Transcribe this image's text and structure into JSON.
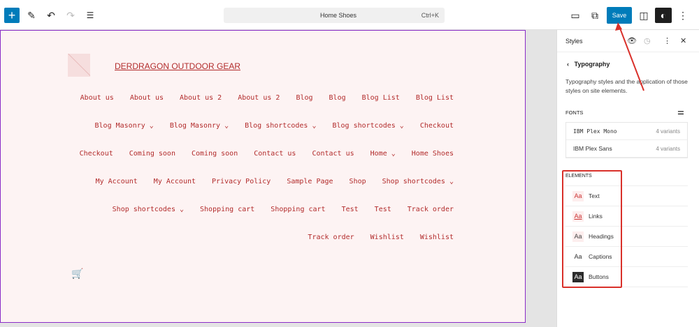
{
  "toolbar": {
    "add": "+",
    "pen": "✎",
    "undo": "↶",
    "redo": "↷",
    "list": "☰",
    "doc_title": "Home Shoes",
    "shortcut": "Ctrl+K",
    "view": "▭",
    "external": "⧉",
    "save": "Save",
    "panel": "◫",
    "styles": "◐",
    "more": "⋮"
  },
  "site": {
    "title": "DERDRAGON OUTDOOR GEAR",
    "nav": [
      "About us",
      "About us",
      "About us 2",
      "About us 2",
      "Blog",
      "Blog",
      "Blog List",
      "Blog List",
      "Blog Masonry ⌄",
      "Blog Masonry ⌄",
      "Blog shortcodes ⌄",
      "Blog shortcodes ⌄",
      "Checkout",
      "Checkout",
      "Coming soon",
      "Coming soon",
      "Contact us",
      "Contact us",
      "Home ⌄",
      "Home Shoes",
      "My Account",
      "My Account",
      "Privacy Policy",
      "Sample Page",
      "Shop",
      "Shop shortcodes ⌄",
      "Shop shortcodes ⌄",
      "Shopping cart",
      "Shopping cart",
      "Test",
      "Test",
      "Track order",
      "Track order",
      "Wishlist",
      "Wishlist"
    ],
    "cart": "🛒"
  },
  "sidebar": {
    "title": "Styles",
    "section": "Typography",
    "description": "Typography styles and the application of those styles on site elements.",
    "fonts_label": "FONTS",
    "fonts": [
      {
        "name": "IBM Plex Mono",
        "variants": "4 variants"
      },
      {
        "name": "IBM Plex Sans",
        "variants": "4 variants"
      }
    ],
    "elements_label": "ELEMENTS",
    "elements": [
      "Text",
      "Links",
      "Headings",
      "Captions",
      "Buttons"
    ],
    "aa": "Aa"
  },
  "colors": {
    "accent": "#007cba",
    "link": "#b22b2b",
    "annotation": "#d9302a"
  }
}
